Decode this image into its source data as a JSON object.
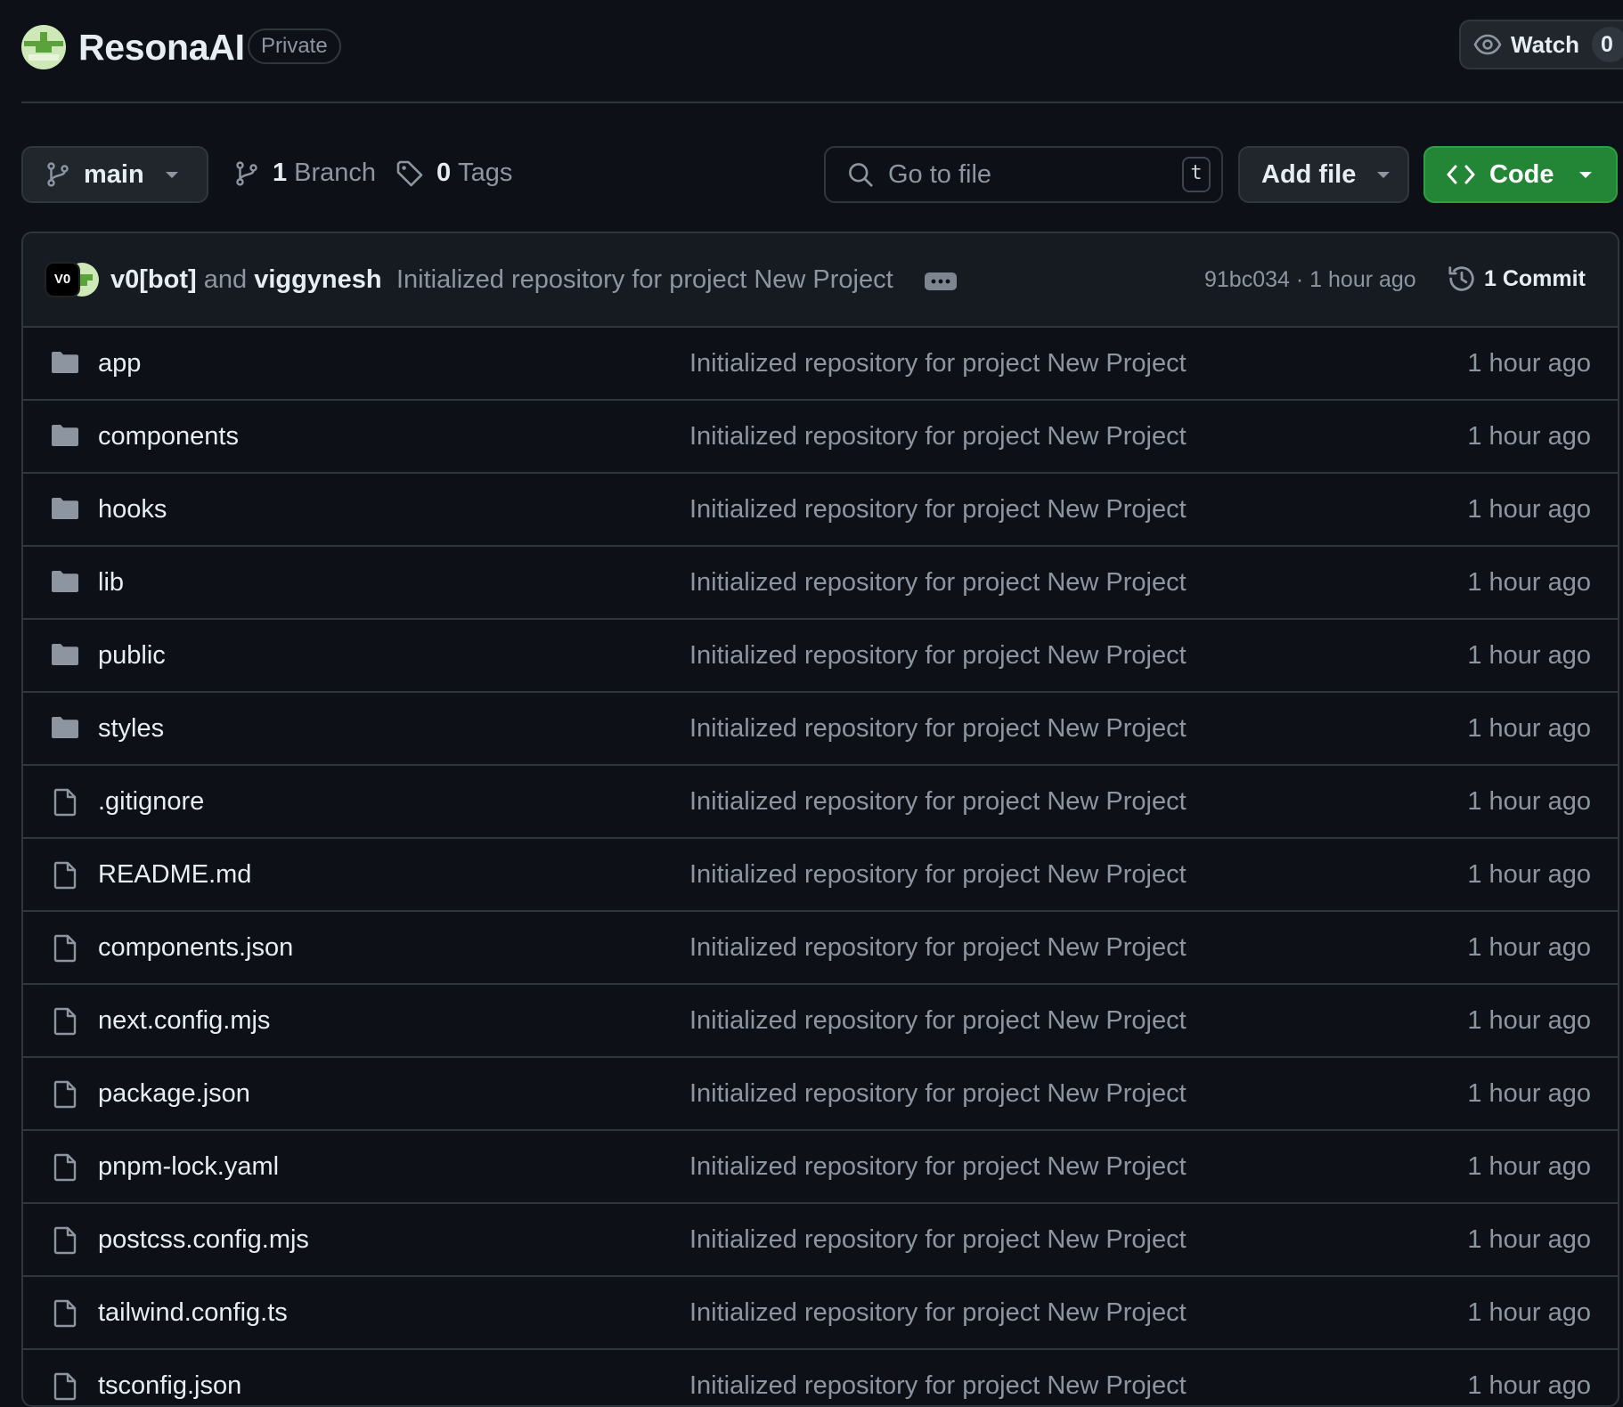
{
  "repo": {
    "name": "ResonaAI",
    "visibility": "Private",
    "watch_label": "Watch",
    "watch_count": "0"
  },
  "toolbar": {
    "branch": "main",
    "branch_count": "1",
    "branch_label": "Branch",
    "tag_count": "0",
    "tag_label": "Tags",
    "goto_placeholder": "Go to file",
    "goto_shortcut": "t",
    "add_file_label": "Add file",
    "code_label": "Code"
  },
  "commit": {
    "bot_avatar_text": "V0",
    "author1": "v0[bot]",
    "joiner": "and",
    "author2": "viggynesh",
    "message": "Initialized repository for project New Project",
    "sha": "91bc034",
    "separator": "·",
    "time": "1 hour ago",
    "count_label": "1 Commit"
  },
  "files": [
    {
      "name": "app",
      "type": "folder",
      "message": "Initialized repository for project New Project",
      "time": "1 hour ago"
    },
    {
      "name": "components",
      "type": "folder",
      "message": "Initialized repository for project New Project",
      "time": "1 hour ago"
    },
    {
      "name": "hooks",
      "type": "folder",
      "message": "Initialized repository for project New Project",
      "time": "1 hour ago"
    },
    {
      "name": "lib",
      "type": "folder",
      "message": "Initialized repository for project New Project",
      "time": "1 hour ago"
    },
    {
      "name": "public",
      "type": "folder",
      "message": "Initialized repository for project New Project",
      "time": "1 hour ago"
    },
    {
      "name": "styles",
      "type": "folder",
      "message": "Initialized repository for project New Project",
      "time": "1 hour ago"
    },
    {
      "name": ".gitignore",
      "type": "file",
      "message": "Initialized repository for project New Project",
      "time": "1 hour ago"
    },
    {
      "name": "README.md",
      "type": "file",
      "message": "Initialized repository for project New Project",
      "time": "1 hour ago"
    },
    {
      "name": "components.json",
      "type": "file",
      "message": "Initialized repository for project New Project",
      "time": "1 hour ago"
    },
    {
      "name": "next.config.mjs",
      "type": "file",
      "message": "Initialized repository for project New Project",
      "time": "1 hour ago"
    },
    {
      "name": "package.json",
      "type": "file",
      "message": "Initialized repository for project New Project",
      "time": "1 hour ago"
    },
    {
      "name": "pnpm-lock.yaml",
      "type": "file",
      "message": "Initialized repository for project New Project",
      "time": "1 hour ago"
    },
    {
      "name": "postcss.config.mjs",
      "type": "file",
      "message": "Initialized repository for project New Project",
      "time": "1 hour ago"
    },
    {
      "name": "tailwind.config.ts",
      "type": "file",
      "message": "Initialized repository for project New Project",
      "time": "1 hour ago"
    },
    {
      "name": "tsconfig.json",
      "type": "file",
      "message": "Initialized repository for project New Project",
      "time": "1 hour ago"
    }
  ],
  "colors": {
    "background": "#0d1117",
    "border": "#30363d",
    "text": "#e6edf3",
    "muted": "#8d96a0",
    "code_button": "#238636",
    "folder_icon": "#8d96a0"
  },
  "icons": {
    "watch": "eye-icon",
    "branch": "git-branch-icon",
    "tag": "tag-icon",
    "search": "search-icon",
    "code": "code-icon",
    "history": "history-icon",
    "folder": "folder-icon",
    "file": "file-icon"
  }
}
